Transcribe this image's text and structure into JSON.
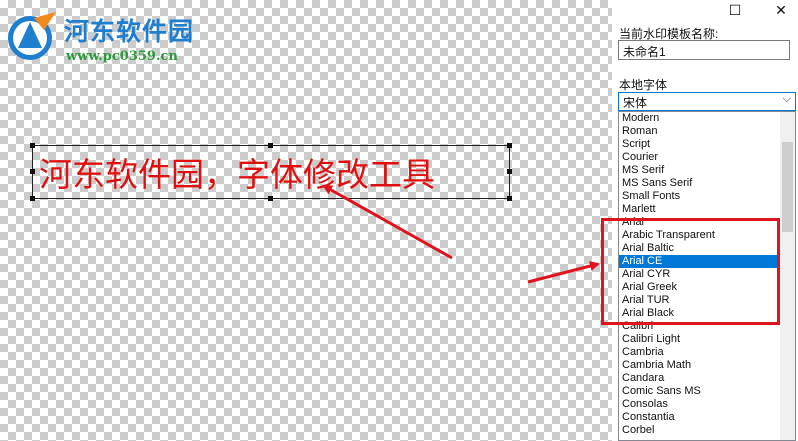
{
  "watermark": {
    "site_name": "河东软件园",
    "site_url": "www.pc0359.cn"
  },
  "canvas": {
    "text": "河东软件园，字体修改工具",
    "text_color": "#e01010"
  },
  "window_controls": {
    "maximize_glyph": "☐",
    "close_glyph": "✕"
  },
  "panel": {
    "template_name_label": "当前水印模板名称:",
    "template_name_value": "未命名1",
    "local_font_label": "本地字体",
    "font_select_value": "宋体",
    "font_select_chevron": "⌵",
    "fonts": [
      "Modern",
      "Roman",
      "Script",
      "Courier",
      "MS Serif",
      "MS Sans Serif",
      "Small Fonts",
      "Marlett",
      "Arial",
      "Arabic Transparent",
      "Arial Baltic",
      "Arial CE",
      "Arial CYR",
      "Arial Greek",
      "Arial TUR",
      "Arial Black",
      "Calibri",
      "Calibri Light",
      "Cambria",
      "Cambria Math",
      "Candara",
      "Comic Sans MS",
      "Consolas",
      "Constantia",
      "Corbel"
    ],
    "selected_font": "Arial CE",
    "accent_color": "#0078d7",
    "highlight_color": "#e0141e"
  }
}
